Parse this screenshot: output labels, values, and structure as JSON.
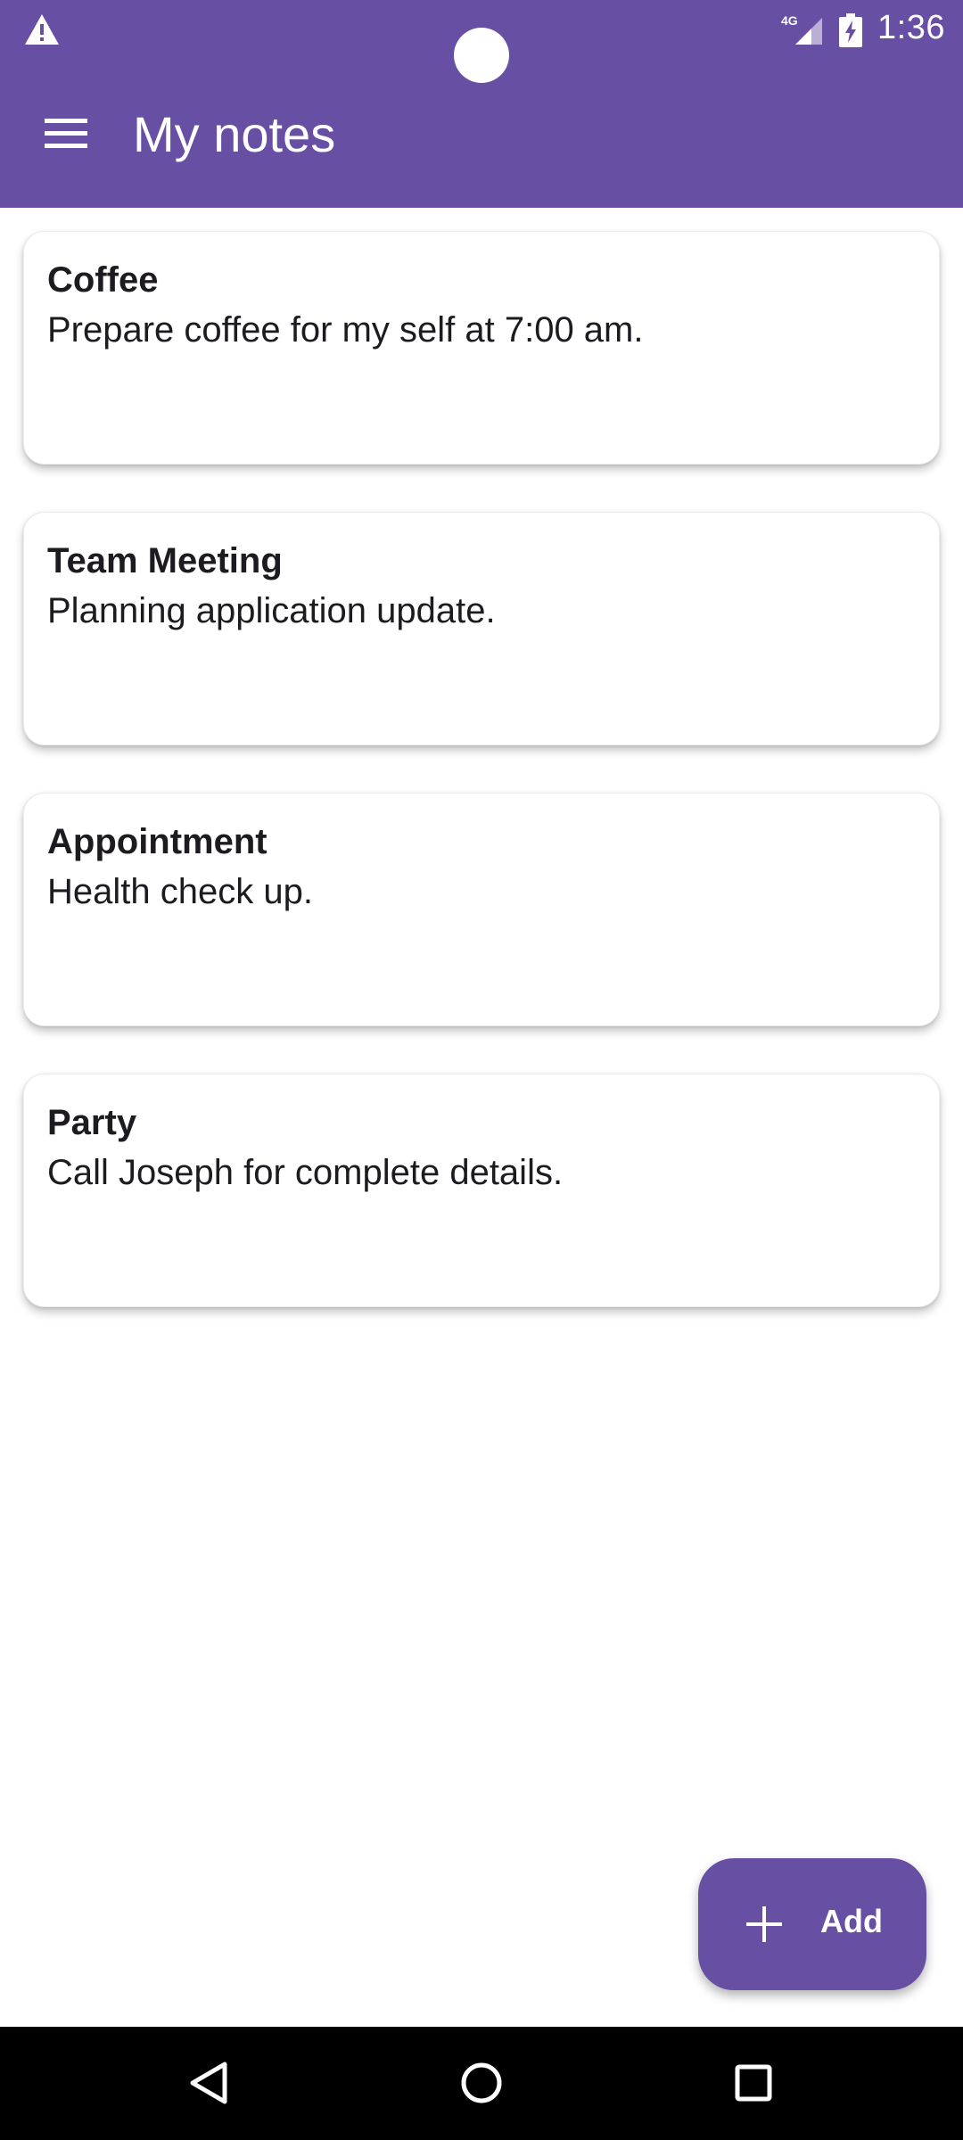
{
  "status_bar": {
    "time": "1:36",
    "network": "4G"
  },
  "app_bar": {
    "title": "My notes",
    "menu_icon": "hamburger-menu-icon"
  },
  "notes": [
    {
      "title": "Coffee",
      "body": "Prepare coffee for my self at 7:00 am."
    },
    {
      "title": "Team Meeting",
      "body": "Planning application update."
    },
    {
      "title": "Appointment",
      "body": "Health check up."
    },
    {
      "title": "Party",
      "body": "Call Joseph for complete details."
    }
  ],
  "fab": {
    "label": "Add",
    "icon": "plus-icon"
  },
  "nav_bar": {
    "buttons": [
      "back-icon",
      "home-icon",
      "recents-icon"
    ]
  },
  "colors": {
    "primary": "#6750a4",
    "on_primary": "#ffffff",
    "card_text": "#1d1b20",
    "nav_background": "#000000"
  }
}
